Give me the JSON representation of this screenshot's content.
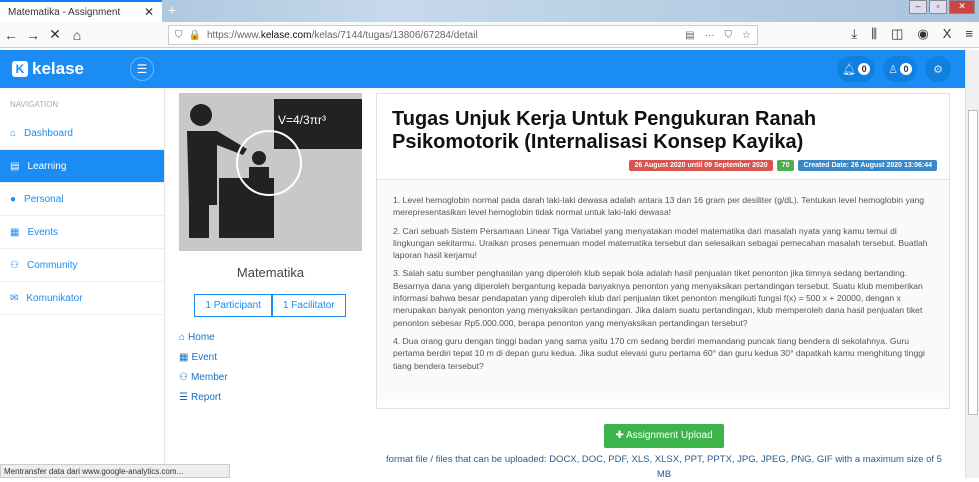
{
  "browser": {
    "tab_title": "Matematika - Assignment",
    "url_prefix": "https://www.",
    "url_domain": "kelase.com",
    "url_path": "/kelas/7144/tugas/13806/67284/detail",
    "status": "Mentransfer data dari www.google-analytics.com..."
  },
  "header": {
    "logo": "kelase",
    "notif_count": "0",
    "user_count": "0"
  },
  "sidebar": {
    "label": "NAVIGATION",
    "items": [
      {
        "label": "Dashboard",
        "icon": "⌂"
      },
      {
        "label": "Learning",
        "icon": "▤"
      },
      {
        "label": "Personal",
        "icon": "●"
      },
      {
        "label": "Events",
        "icon": "▦"
      },
      {
        "label": "Community",
        "icon": "⚇"
      },
      {
        "label": "Komunikator",
        "icon": "✉"
      }
    ]
  },
  "course": {
    "subject": "Matematika",
    "participants": "1 Participant",
    "facilitators": "1 Facilitator",
    "formula": "V=4/3πr³",
    "links": [
      {
        "label": "Home",
        "icon": "⌂"
      },
      {
        "label": "Event",
        "icon": "▦"
      },
      {
        "label": "Member",
        "icon": "⚇"
      },
      {
        "label": "Report",
        "icon": "☰"
      }
    ]
  },
  "assignment": {
    "title": "Tugas Unjuk Kerja Untuk Pengukuran Ranah Psikomotorik (Internalisasi Konsep Kayika)",
    "period": "26 August 2020 until 09 September 2020",
    "score": "70",
    "created": "Created Date: 26 August 2020 13:06:44",
    "questions": [
      "1. Level hemoglobin normal pada darah laki-laki dewasa adalah antara 13 dan 16 gram per desiliter (g/dL). Tentukan level hemoglobin yang merepresentasikan level hemoglobin tidak normal untuk laki-laki dewasa!",
      "2. Cari sebuah Sistem Persamaan Linear Tiga Variabel yang menyatakan model matematika dari masalah nyata yang kamu temui di lingkungan sekitarmu. Uraikan proses penemuan model matematika tersebut dan selesaikan sebagai pemecahan masalah tersebut. Buatlah laporan hasil kerjamu!",
      "3. Salah satu sumber penghasilan yang diperoleh klub sepak bola adalah hasil penjualan tiket penonton jika timnya sedang bertanding. Besarnya dana yang diperoleh bergantung kepada banyaknya penonton yang menyaksikan pertandingan tersebut. Suatu klub memberikan informasi bahwa besar pendapatan yang diperoleh klub dari penjualan tiket penonton mengikuti fungsi f(x) = 500 x + 20000, dengan x merupakan banyak penonton yang menyaksikan pertandingan. Jika dalam suatu pertandingan, klub memperoleh dana hasil penjualan tiket penonton sebesar Rp5.000.000, berapa penonton yang menyaksikan pertandingan tersebut?",
      "4. Dua orang guru dengan tinggi badan yang sama yaitu 170 cm sedang berdiri memandang puncak tiang bendera di sekolahnya. Guru pertama berdiri tepat 10 m di depan guru kedua. Jika sudut elevasi guru pertama 60° dan guru kedua 30° dapatkah kamu menghitung tinggi tiang bendera tersebut?"
    ]
  },
  "upload": {
    "label": "Assignment Upload",
    "formats": "format file / files that can be uploaded: DOCX, DOC, PDF, XLS, XLSX, PPT, PPTX, JPG, JPEG, PNG, GIF with a maximum size of 5 MB"
  },
  "colors": {
    "primary": "#1a8cf4",
    "danger": "#d9534f",
    "success": "#4cae4c",
    "info": "#3a87c8"
  }
}
